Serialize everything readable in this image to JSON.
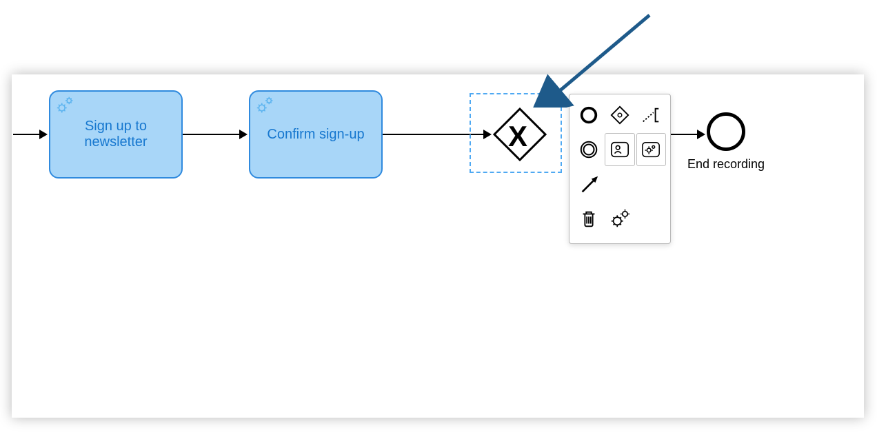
{
  "tasks": {
    "signup": {
      "label": "Sign up to\nnewsletter"
    },
    "confirm": {
      "label": "Confirm sign-up"
    }
  },
  "gateway": {
    "symbol": "X",
    "type": "exclusive"
  },
  "end_event": {
    "label": "End recording"
  },
  "context_pad": {
    "items": [
      {
        "name": "append-end-event"
      },
      {
        "name": "append-gateway"
      },
      {
        "name": "append-text-annotation"
      },
      {
        "name": "append-intermediate-event"
      },
      {
        "name": "append-user-task"
      },
      {
        "name": "append-service-task"
      },
      {
        "name": "connect-tool"
      },
      {
        "name": "delete"
      },
      {
        "name": "change-type"
      }
    ]
  },
  "colors": {
    "task_fill": "#a8d6f8",
    "task_border": "#2f8ade",
    "task_text": "#1677cf",
    "selection_dash": "#4fa9f2",
    "pointer_arrow": "#1e5a8a"
  }
}
